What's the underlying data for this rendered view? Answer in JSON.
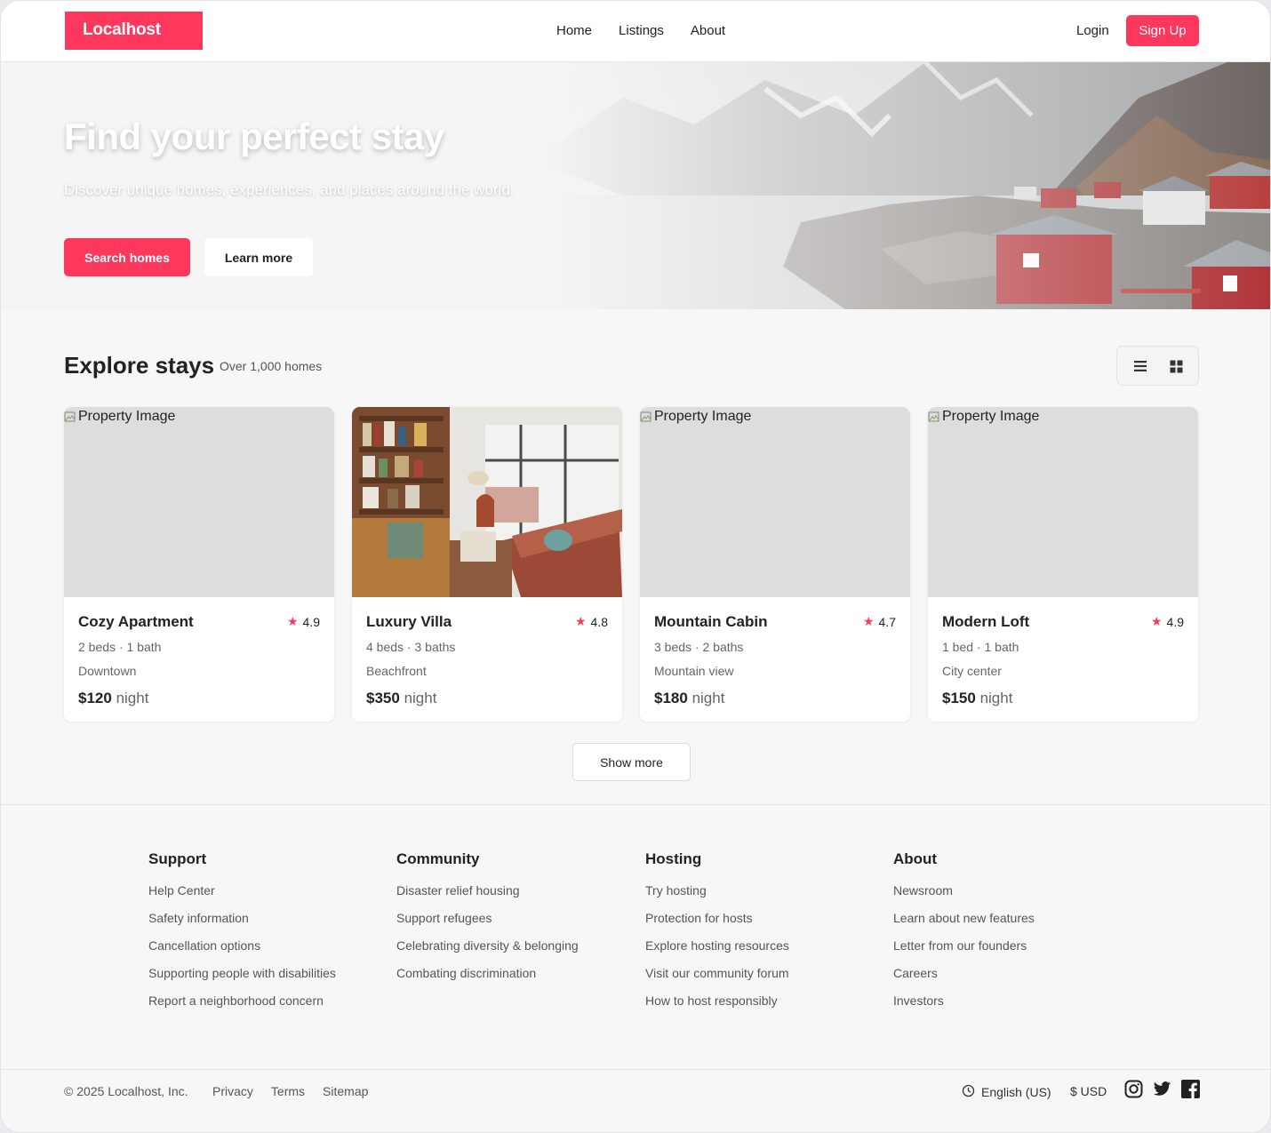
{
  "header": {
    "logo": "Localhost",
    "nav": [
      "Home",
      "Listings",
      "About"
    ],
    "login": "Login",
    "signup": "Sign Up"
  },
  "hero": {
    "title": "Find your perfect stay",
    "subtitle": "Discover unique homes, experiences, and places around the world.",
    "primary_button": "Search homes",
    "secondary_button": "Learn more"
  },
  "explore": {
    "title": "Explore stays",
    "count": "Over 1,000 homes",
    "view_toggle": [
      "list-icon",
      "grid-icon"
    ],
    "image_alt": "Property Image",
    "listings": [
      {
        "name": "Cozy Apartment",
        "rating": "4.9",
        "beds": "2 beds · 1 bath",
        "location": "Downtown",
        "price": "$120",
        "unit": "night",
        "image_loaded": false
      },
      {
        "name": "Luxury Villa",
        "rating": "4.8",
        "beds": "4 beds · 3 baths",
        "location": "Beachfront",
        "price": "$350",
        "unit": "night",
        "image_loaded": true
      },
      {
        "name": "Mountain Cabin",
        "rating": "4.7",
        "beds": "3 beds · 2 baths",
        "location": "Mountain view",
        "price": "$180",
        "unit": "night",
        "image_loaded": false
      },
      {
        "name": "Modern Loft",
        "rating": "4.9",
        "beds": "1 bed · 1 bath",
        "location": "City center",
        "price": "$150",
        "unit": "night",
        "image_loaded": false
      }
    ],
    "show_more": "Show more"
  },
  "footer": {
    "columns": [
      {
        "title": "Support",
        "links": [
          "Help Center",
          "Safety information",
          "Cancellation options",
          "Supporting people with disabilities",
          "Report a neighborhood concern"
        ]
      },
      {
        "title": "Community",
        "links": [
          "Disaster relief housing",
          "Support refugees",
          "Celebrating diversity & belonging",
          "Combating discrimination"
        ]
      },
      {
        "title": "Hosting",
        "links": [
          "Try hosting",
          "Protection for hosts",
          "Explore hosting resources",
          "Visit our community forum",
          "How to host responsibly"
        ]
      },
      {
        "title": "About",
        "links": [
          "Newsroom",
          "Learn about new features",
          "Letter from our founders",
          "Careers",
          "Investors"
        ]
      }
    ],
    "copyright": "© 2025 Localhost, Inc.",
    "bottom_links": [
      "Privacy",
      "Terms",
      "Sitemap"
    ],
    "language": "English (US)",
    "currency": "$ USD",
    "socials": [
      "instagram-icon",
      "twitter-icon",
      "facebook-icon"
    ]
  },
  "colors": {
    "accent": "#fe385c",
    "background": "#f7f7f7",
    "text": "#222222",
    "muted": "#555555"
  }
}
